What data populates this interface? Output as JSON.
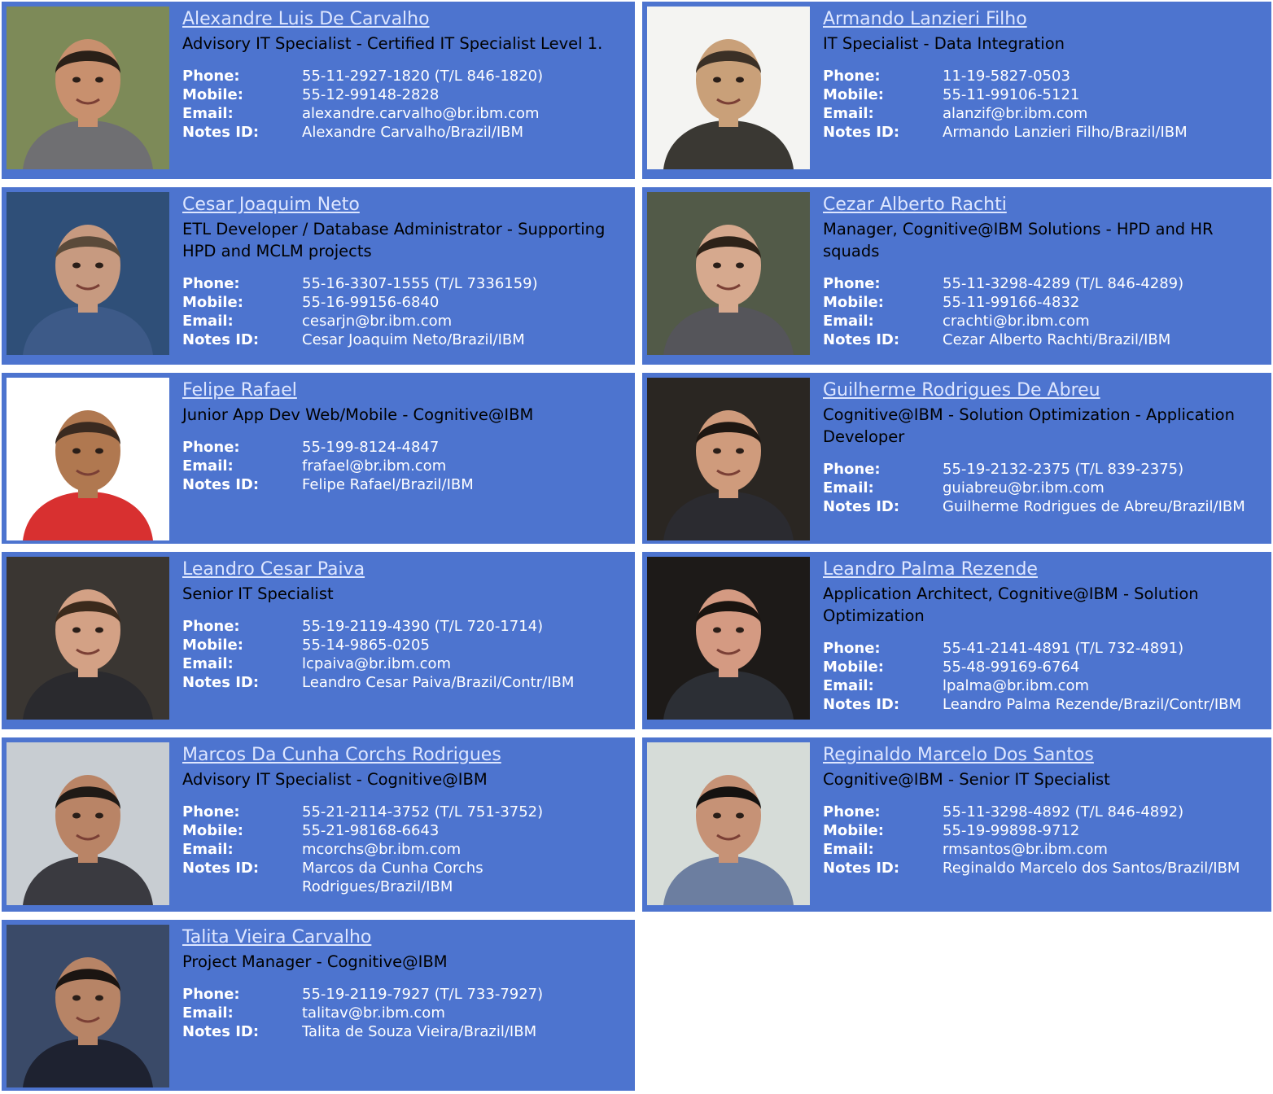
{
  "labels": {
    "phone": "Phone:",
    "mobile": "Mobile:",
    "email": "Email:",
    "notes": "Notes ID:"
  },
  "colors": {
    "card_background": "#4d74cf",
    "name_link": "#dde6ff",
    "detail_text": "#ffffff"
  },
  "people": [
    {
      "name": "Alexandre Luis De Carvalho",
      "title": "Advisory IT Specialist - Certified IT Specialist Level 1.",
      "phone": "55-11-2927-1820 (T/L 846-1820)",
      "mobile": "55-12-99148-2828",
      "email": "alexandre.carvalho@br.ibm.com",
      "notes_id": "Alexandre Carvalho/Brazil/IBM",
      "photo_icon": "person-photo"
    },
    {
      "name": "Armando Lanzieri Filho",
      "title": "IT Specialist - Data Integration",
      "phone": "11-19-5827-0503",
      "mobile": "55-11-99106-5121",
      "email": "alanzif@br.ibm.com",
      "notes_id": "Armando Lanzieri Filho/Brazil/IBM",
      "photo_icon": "person-photo"
    },
    {
      "name": "Cesar Joaquim Neto",
      "title": "ETL Developer / Database Administrator - Supporting HPD and MCLM projects",
      "phone": "55-16-3307-1555 (T/L 7336159)",
      "mobile": "55-16-99156-6840",
      "email": "cesarjn@br.ibm.com",
      "notes_id": "Cesar Joaquim Neto/Brazil/IBM",
      "photo_icon": "person-photo"
    },
    {
      "name": "Cezar Alberto Rachti",
      "title": "Manager, Cognitive@IBM Solutions - HPD and HR squads",
      "phone": "55-11-3298-4289 (T/L 846-4289)",
      "mobile": "55-11-99166-4832",
      "email": "crachti@br.ibm.com",
      "notes_id": "Cezar Alberto Rachti/Brazil/IBM",
      "photo_icon": "person-photo"
    },
    {
      "name": "Felipe Rafael",
      "title": "Junior App Dev Web/Mobile - Cognitive@IBM",
      "phone": "55-199-8124-4847",
      "mobile": null,
      "email": "frafael@br.ibm.com",
      "notes_id": "Felipe Rafael/Brazil/IBM",
      "photo_icon": "person-photo"
    },
    {
      "name": "Guilherme Rodrigues De Abreu",
      "title": "Cognitive@IBM - Solution Optimization - Application Developer",
      "phone": "55-19-2132-2375 (T/L 839-2375)",
      "mobile": null,
      "email": "guiabreu@br.ibm.com",
      "notes_id": "Guilherme Rodrigues de Abreu/Brazil/IBM",
      "photo_icon": "person-photo"
    },
    {
      "name": "Leandro Cesar Paiva",
      "title": "Senior IT Specialist",
      "phone": "55-19-2119-4390 (T/L 720-1714)",
      "mobile": "55-14-9865-0205",
      "email": "lcpaiva@br.ibm.com",
      "notes_id": "Leandro Cesar Paiva/Brazil/Contr/IBM",
      "photo_icon": "person-photo"
    },
    {
      "name": "Leandro Palma Rezende",
      "title": "Application Architect, Cognitive@IBM - Solution Optimization",
      "phone": "55-41-2141-4891 (T/L 732-4891)",
      "mobile": "55-48-99169-6764",
      "email": "lpalma@br.ibm.com",
      "notes_id": "Leandro Palma Rezende/Brazil/Contr/IBM",
      "photo_icon": "person-photo"
    },
    {
      "name": "Marcos Da Cunha Corchs Rodrigues",
      "title": "Advisory IT Specialist - Cognitive@IBM",
      "phone": "55-21-2114-3752 (T/L 751-3752)",
      "mobile": "55-21-98168-6643",
      "email": "mcorchs@br.ibm.com",
      "notes_id": "Marcos da Cunha Corchs Rodrigues/Brazil/IBM",
      "photo_icon": "person-photo"
    },
    {
      "name": "Reginaldo Marcelo Dos Santos",
      "title": "Cognitive@IBM - Senior IT Specialist",
      "phone": "55-11-3298-4892 (T/L 846-4892)",
      "mobile": "55-19-99898-9712",
      "email": "rmsantos@br.ibm.com",
      "notes_id": "Reginaldo Marcelo dos Santos/Brazil/IBM",
      "photo_icon": "person-photo"
    },
    {
      "name": "Talita Vieira Carvalho",
      "title": "Project Manager - Cognitive@IBM",
      "phone": "55-19-2119-7927 (T/L 733-7927)",
      "mobile": null,
      "email": "talitav@br.ibm.com",
      "notes_id": "Talita de Souza Vieira/Brazil/IBM",
      "photo_icon": "person-photo"
    }
  ]
}
